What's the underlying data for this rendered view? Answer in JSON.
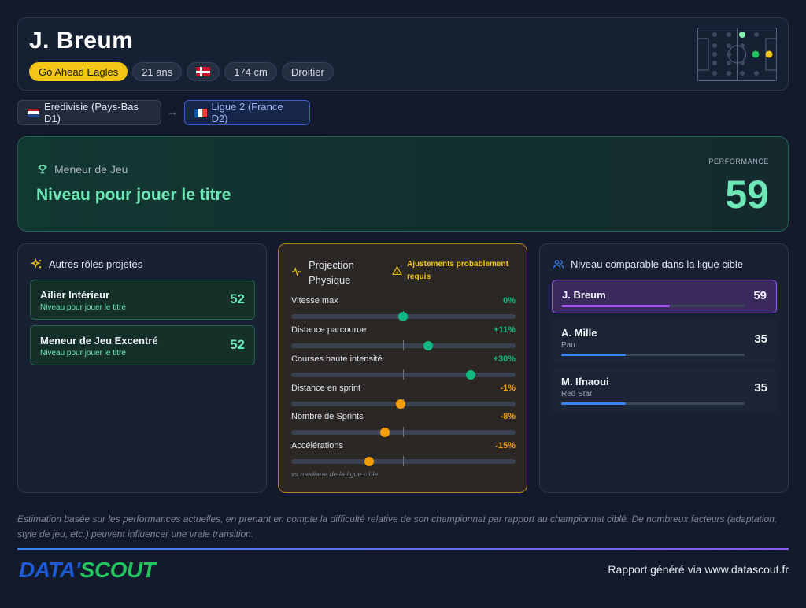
{
  "player": {
    "name": "J. Breum",
    "club": "Go Ahead Eagles",
    "age": "21 ans",
    "nationality_flag": "denmark-flag-icon",
    "height": "174 cm",
    "foot": "Droitier"
  },
  "leagues": {
    "from": "Eredivisie (Pays-Bas D1)",
    "from_flag": "netherlands-flag-icon",
    "arrow": "→",
    "to": "Ligue 2 (France D2)",
    "to_flag": "france-flag-icon"
  },
  "main_role": {
    "icon": "trophy-icon",
    "role": "Meneur de Jeu",
    "level": "Niveau pour jouer le titre",
    "performance_label": "PERFORMANCE",
    "performance_value": "59",
    "accent_color": "#6ee7b7"
  },
  "other_roles": {
    "title": "Autres rôles projetés",
    "icon": "sparkles-icon",
    "items": [
      {
        "name": "Ailier Intérieur",
        "level": "Niveau pour jouer le titre",
        "score": "52"
      },
      {
        "name": "Meneur de Jeu Excentré",
        "level": "Niveau pour jouer le titre",
        "score": "52"
      }
    ]
  },
  "physical": {
    "title": "Projection Physique",
    "icon": "activity-icon",
    "warning": "Ajustements probablement requis",
    "warning_icon": "warning-icon",
    "footnote": "vs médiane de la ligue cible",
    "metrics": [
      {
        "label": "Vitesse max",
        "value": "0%",
        "pct": 0,
        "color": "#10b981"
      },
      {
        "label": "Distance parcourue",
        "value": "+11%",
        "pct": 11,
        "color": "#10b981"
      },
      {
        "label": "Courses haute intensité",
        "value": "+30%",
        "pct": 30,
        "color": "#10b981"
      },
      {
        "label": "Distance en sprint",
        "value": "-1%",
        "pct": -1,
        "color": "#f59e0b"
      },
      {
        "label": "Nombre de Sprints",
        "value": "-8%",
        "pct": -8,
        "color": "#f59e0b"
      },
      {
        "label": "Accélérations",
        "value": "-15%",
        "pct": -15,
        "color": "#f59e0b"
      }
    ]
  },
  "comparison": {
    "title": "Niveau comparable dans la ligue cible",
    "icon": "users-icon",
    "rows": [
      {
        "name": "J. Breum",
        "club": "",
        "score": "59",
        "fill": 0.59,
        "color": "#a855f7",
        "highlight": true
      },
      {
        "name": "A. Mille",
        "club": "Pau",
        "score": "35",
        "fill": 0.35,
        "color": "#3b82f6",
        "highlight": false
      },
      {
        "name": "M. Ifnaoui",
        "club": "Red Star",
        "score": "35",
        "fill": 0.35,
        "color": "#3b82f6",
        "highlight": false
      }
    ]
  },
  "footer": {
    "disclaimer": "Estimation basée sur les performances actuelles, en prenant en compte la difficulté relative de son championnat par rapport au championnat ciblé. De nombreux facteurs (adaptation, style de jeu, etc.) peuvent influencer une vraie transition.",
    "logo_part1": "DATA'",
    "logo_part2": "SCOUT",
    "report_text": "Rapport généré via www.datascout.fr"
  }
}
